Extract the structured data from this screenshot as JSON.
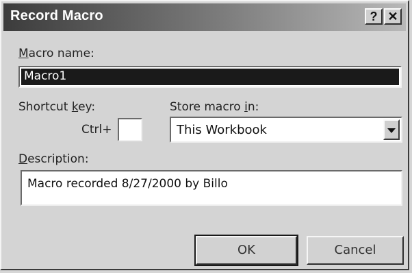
{
  "window": {
    "title": "Record Macro",
    "help_icon": "question-mark",
    "close_icon": "x-mark",
    "help_glyph": "?",
    "close_glyph": "✕"
  },
  "macro_name": {
    "label": "Macro name:",
    "value": "Macro1"
  },
  "shortcut": {
    "label": "Shortcut key:",
    "prefix": "Ctrl+",
    "value": ""
  },
  "store": {
    "label": "Store macro in:",
    "selected": "This Workbook"
  },
  "description": {
    "label": "Description:",
    "value": "Macro recorded 8/27/2000 by Billo"
  },
  "buttons": {
    "ok": "OK",
    "cancel": "Cancel"
  }
}
